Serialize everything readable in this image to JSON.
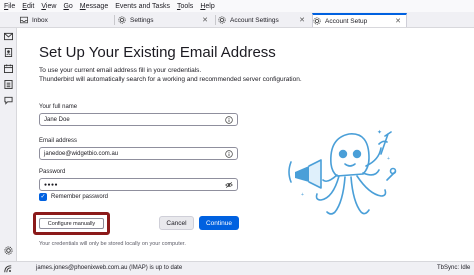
{
  "menubar": {
    "items": [
      {
        "u": "F",
        "rest": "ile"
      },
      {
        "u": "E",
        "rest": "dit"
      },
      {
        "u": "V",
        "rest": "iew"
      },
      {
        "u": "G",
        "rest": "o"
      },
      {
        "u": "M",
        "rest": "essage"
      },
      {
        "u": "",
        "rest": "Events and Tasks"
      },
      {
        "u": "T",
        "rest": "ools"
      },
      {
        "u": "H",
        "rest": "elp"
      }
    ]
  },
  "tabs": [
    {
      "label": "Inbox",
      "icon": "inbox-icon",
      "active": false
    },
    {
      "label": "Settings",
      "icon": "settings-icon",
      "active": false
    },
    {
      "label": "Account Settings",
      "icon": "settings-icon",
      "active": false
    },
    {
      "label": "Account Setup",
      "icon": "settings-icon",
      "active": true
    }
  ],
  "page": {
    "title": "Set Up Your Existing Email Address",
    "intro_line1": "To use your current email address fill in your credentials.",
    "intro_line2": "Thunderbird will automatically search for a working and recommended server configuration."
  },
  "form": {
    "name_label": "Your full name",
    "name_value": "Jane Doe",
    "email_label": "Email address",
    "email_value": "janedoe@widgetbio.com.au",
    "password_label": "Password",
    "password_value": "●●●●",
    "remember_label": "Remember password",
    "remember_checked": true
  },
  "buttons": {
    "configure_manually": "Configure manually",
    "cancel": "Cancel",
    "continue": "Continue"
  },
  "note": "Your credentials will only be stored locally on your computer.",
  "status": {
    "text": "james.jones@phoenixweb.com.au (IMAP) is up to date",
    "right": "TbSync: Idle"
  },
  "colors": {
    "accent": "#0061e0",
    "highlight_border": "#8b1a1a",
    "mascot": "#4a9fd8"
  }
}
